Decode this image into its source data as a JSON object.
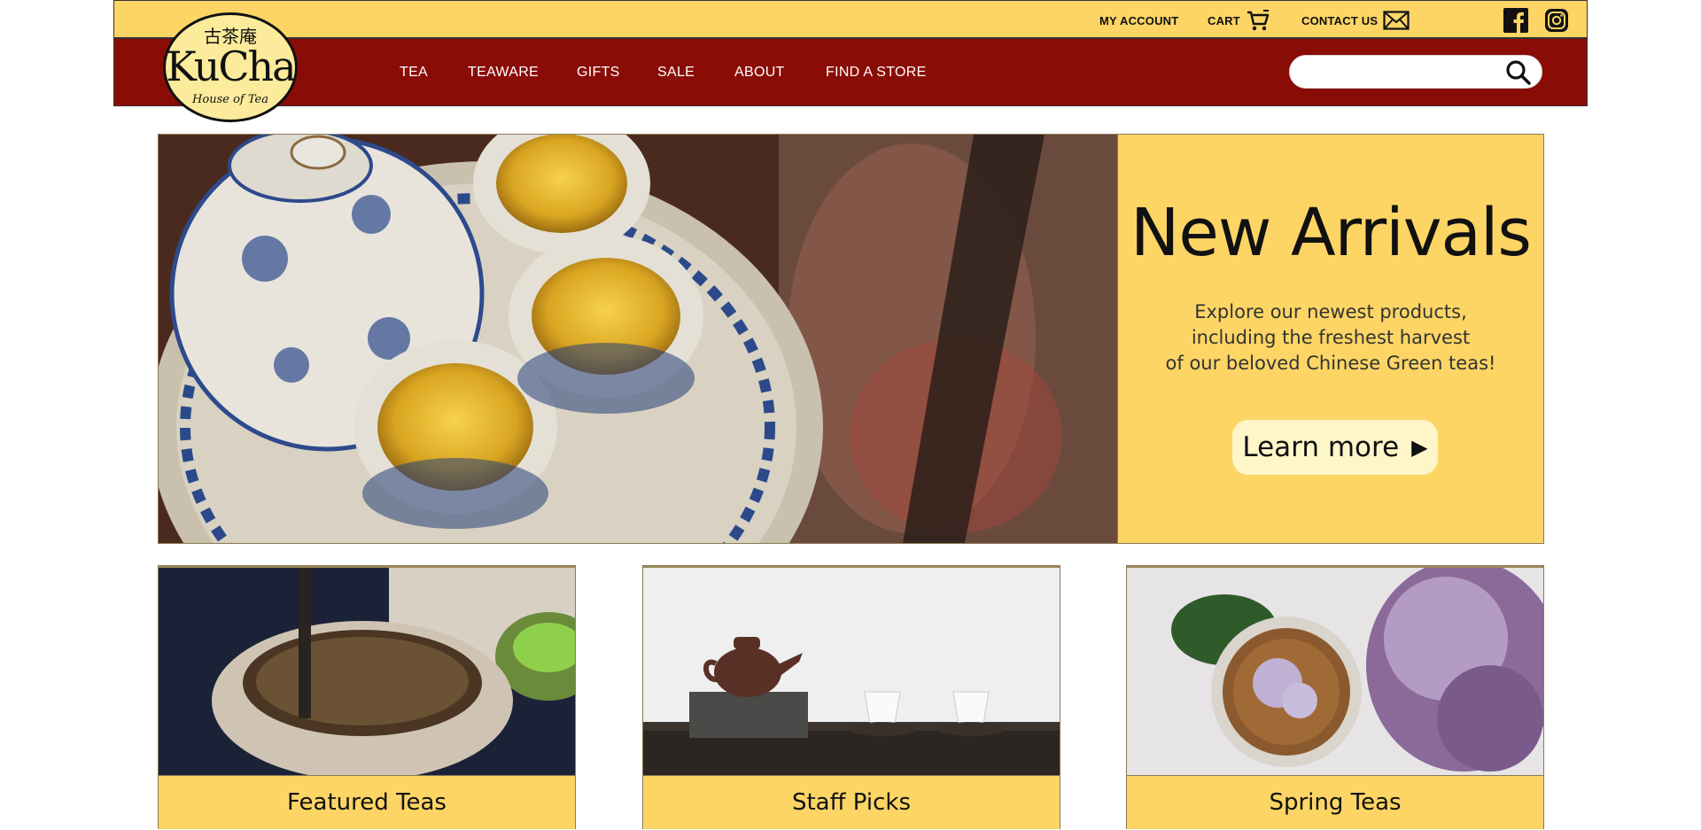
{
  "header": {
    "utility_links": [
      {
        "label": "MY ACCOUNT",
        "icon": ""
      },
      {
        "label": "CART",
        "icon": "cart-icon"
      },
      {
        "label": "CONTACT US",
        "icon": "envelope-icon"
      }
    ],
    "social": [
      "facebook-icon",
      "instagram-icon"
    ]
  },
  "logo": {
    "chinese": "古茶庵",
    "name": "KuCha",
    "tagline": "House of Tea"
  },
  "nav": {
    "items": [
      "TEA",
      "TEAWARE",
      "GIFTS",
      "SALE",
      "ABOUT",
      "FIND A STORE"
    ],
    "search_placeholder": ""
  },
  "hero": {
    "title": "New Arrivals",
    "text_lines": [
      "Explore our newest products,",
      "including the freshest harvest",
      "of our beloved Chinese Green teas!"
    ],
    "button_label": "Learn more",
    "button_arrow": "▶"
  },
  "cards": [
    {
      "label": "Featured Teas"
    },
    {
      "label": "Staff Picks"
    },
    {
      "label": "Spring Teas"
    }
  ],
  "colors": {
    "yellow": "#fcd565",
    "maroon": "#8a0c07",
    "cream": "#fef6c9"
  }
}
